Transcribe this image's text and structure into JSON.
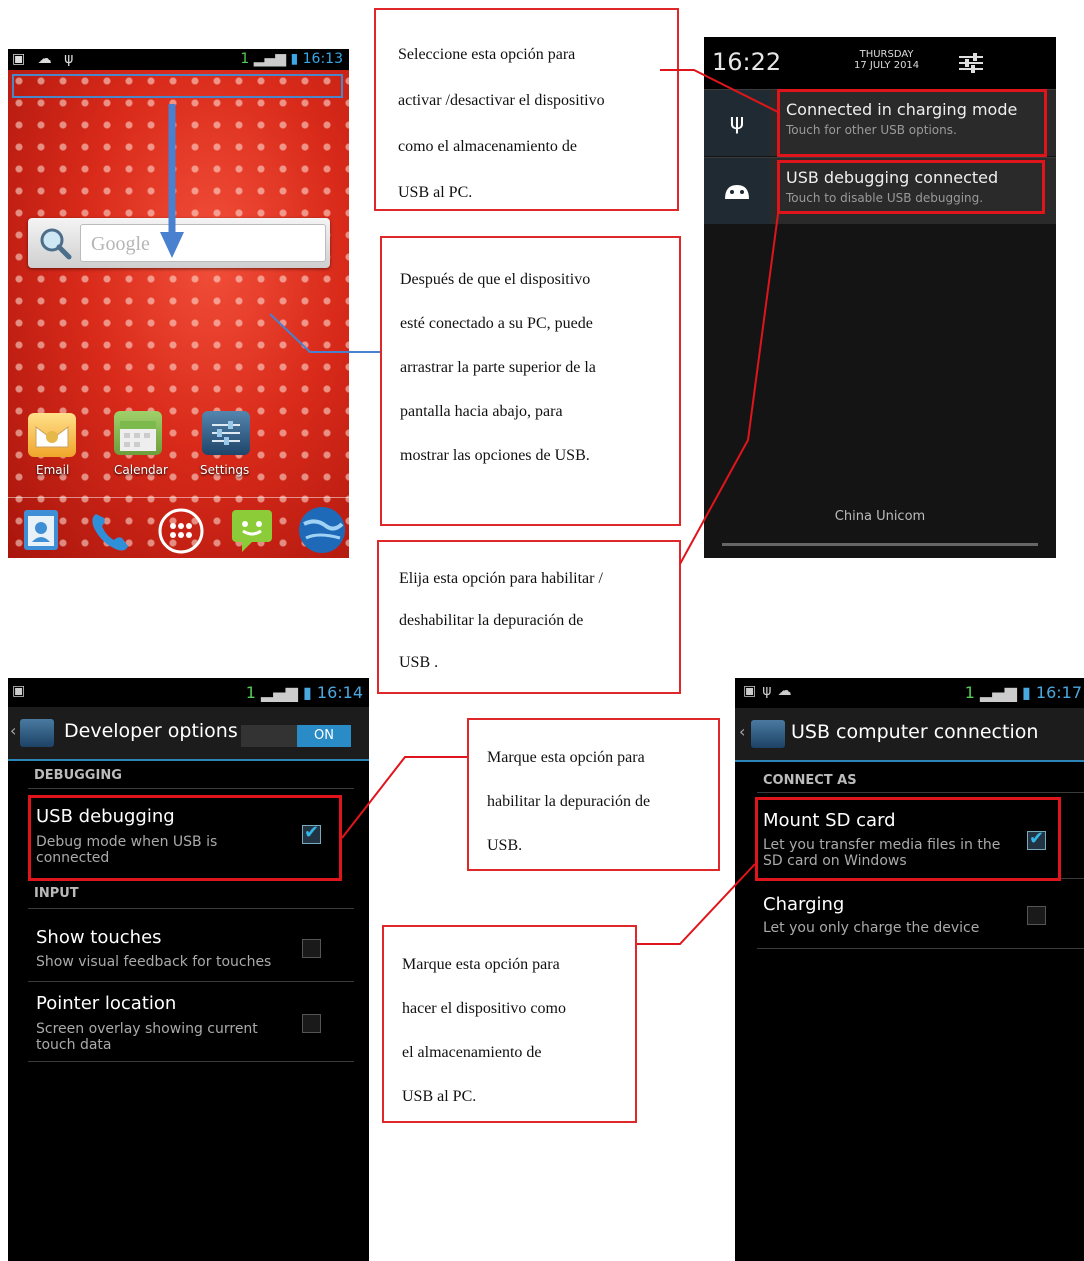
{
  "home_screen": {
    "status_time": "16:13",
    "status_sim": "1",
    "search_placeholder": "Google",
    "apps": [
      {
        "label": "Email",
        "icon": "email-icon"
      },
      {
        "label": "Calendar",
        "icon": "calendar-icon"
      },
      {
        "label": "Settings",
        "icon": "settings-icon"
      }
    ],
    "dock": [
      "contacts-icon",
      "phone-icon",
      "apps-grid-icon",
      "messaging-icon",
      "browser-icon"
    ]
  },
  "notification_screen": {
    "time": "16:22",
    "day": "THURSDAY",
    "date": "17 JULY 2014",
    "notifications": [
      {
        "title": "Connected in charging mode",
        "subtitle": "Touch for other USB options.",
        "icon": "usb-icon"
      },
      {
        "title": "USB debugging connected",
        "subtitle": "Touch to disable USB debugging.",
        "icon": "android-icon"
      }
    ],
    "carrier": "China Unicom"
  },
  "developer_screen": {
    "status_time": "16:14",
    "status_sim": "1",
    "title": "Developer options",
    "toggle_label": "ON",
    "sections": [
      {
        "header": "DEBUGGING"
      },
      {
        "header": "INPUT"
      }
    ],
    "items": [
      {
        "title": "USB debugging",
        "subtitle": "Debug mode when USB is connected",
        "checked": true
      },
      {
        "title": "Show touches",
        "subtitle": "Show visual feedback for touches",
        "checked": false
      },
      {
        "title": "Pointer location",
        "subtitle": "Screen overlay showing current touch data",
        "checked": false
      }
    ]
  },
  "usb_screen": {
    "status_time": "16:17",
    "status_sim": "1",
    "title": "USB computer connection",
    "section": "CONNECT AS",
    "items": [
      {
        "title": "Mount SD card",
        "subtitle": "Let you transfer media files in the SD card on Windows",
        "checked": true
      },
      {
        "title": "Charging",
        "subtitle": "Let you only charge the device",
        "checked": false
      }
    ]
  },
  "callouts": {
    "usb_storage": [
      "Seleccione esta opción para",
      "activar /desactivar el dispositivo",
      "como el almacenamiento de",
      "USB al PC."
    ],
    "drag_down": [
      "Después de que el dispositivo",
      "esté conectado a su PC, puede",
      "arrastrar la parte superior de la",
      "pantalla hacia abajo, para",
      "mostrar las opciones de USB."
    ],
    "debugging_toggle": [
      "Elija esta opción para habilitar /",
      "deshabilitar la depuración de",
      "USB ."
    ],
    "mark_debugging": [
      "Marque esta opción para",
      "habilitar la depuración de",
      "USB."
    ],
    "mark_storage": [
      "Marque esta opción para",
      "hacer el dispositivo como",
      "el almacenamiento de",
      "USB al PC."
    ]
  }
}
